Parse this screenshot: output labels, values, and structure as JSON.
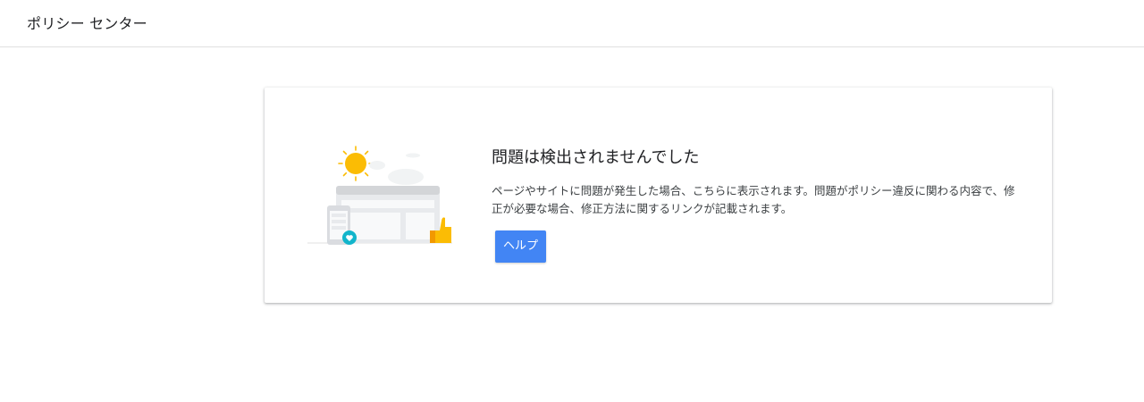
{
  "header": {
    "title": "ポリシー センター"
  },
  "card": {
    "title": "問題は検出されませんでした",
    "description": "ページやサイトに問題が発生した場合、こちらに表示されます。問題がポリシー違反に関わる内容で、修正が必要な場合、修正方法に関するリンクが記載されます。",
    "help_label": "ヘルプ",
    "illustration_icon": "no-issues-illustration"
  },
  "colors": {
    "accent": "#4285f4",
    "sun": "#fbbc04",
    "teal": "#12b5cb",
    "thumb": "#f9ab00"
  }
}
